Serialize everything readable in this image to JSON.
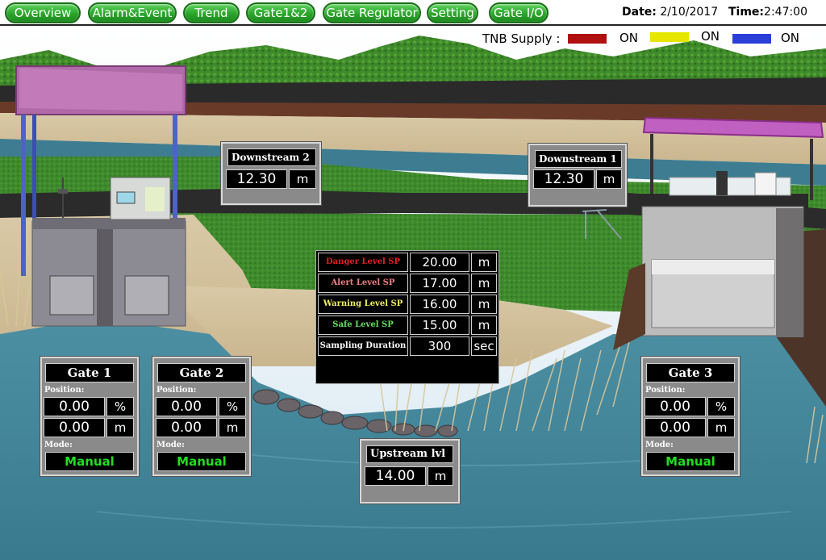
{
  "nav": {
    "overview": "Overview",
    "alarm_event": "Alarm&Event",
    "trend": "Trend",
    "gate12": "Gate1&2",
    "gate_regulator": "Gate Regulator",
    "setting": "Setting",
    "gate_io": "Gate I/O"
  },
  "datetime": {
    "date_label": "Date:",
    "date": "2/10/2017",
    "time_label": "Time:",
    "time": "2:47:00"
  },
  "tnb": {
    "label": "TNB Supply :",
    "phases": [
      {
        "color": "#b01010",
        "status": "ON"
      },
      {
        "color": "#e6e600",
        "status": "ON"
      },
      {
        "color": "#2a3ed8",
        "status": "ON"
      }
    ]
  },
  "downstream2": {
    "title": "Downstream 2",
    "value": "12.30",
    "unit": "m"
  },
  "downstream1": {
    "title": "Downstream 1",
    "value": "12.30",
    "unit": "m"
  },
  "setpoints": [
    {
      "label": "Danger Level SP",
      "value": "20.00",
      "unit": "m",
      "color": "#e02020"
    },
    {
      "label": "Alert Level SP",
      "value": "17.00",
      "unit": "m",
      "color": "#f08080"
    },
    {
      "label": "Warning Level SP",
      "value": "16.00",
      "unit": "m",
      "color": "#f0f060"
    },
    {
      "label": "Safe Level SP",
      "value": "15.00",
      "unit": "m",
      "color": "#60e060"
    },
    {
      "label": "Sampling Duration",
      "value": "300",
      "unit": "sec",
      "color": "#ffffff"
    }
  ],
  "gates": [
    {
      "title": "Gate 1",
      "position_label": "Position:",
      "pct": "0.00",
      "pct_unit": "%",
      "m": "0.00",
      "m_unit": "m",
      "mode_label": "Mode:",
      "mode": "Manual"
    },
    {
      "title": "Gate 2",
      "position_label": "Position:",
      "pct": "0.00",
      "pct_unit": "%",
      "m": "0.00",
      "m_unit": "m",
      "mode_label": "Mode:",
      "mode": "Manual"
    },
    {
      "title": "Gate 3",
      "position_label": "Position:",
      "pct": "0.00",
      "pct_unit": "%",
      "m": "0.00",
      "m_unit": "m",
      "mode_label": "Mode:",
      "mode": "Manual"
    }
  ],
  "upstream": {
    "title": "Upstream lvl",
    "value": "14.00",
    "unit": "m"
  }
}
